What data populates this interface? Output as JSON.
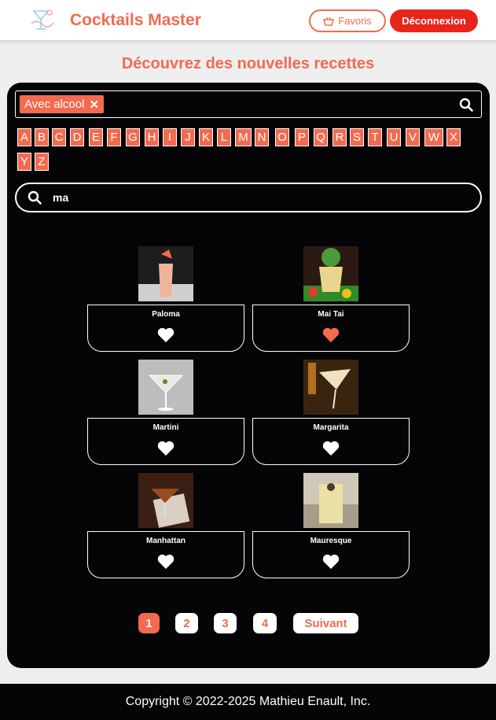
{
  "header": {
    "brand": "Cocktails Master",
    "favorites_label": "Favoris",
    "logout_label": "Déconnexion"
  },
  "page_title": "Découvrez des nouvelles recettes",
  "filter": {
    "tag_label": "Avec alcool",
    "tag_remove": "✕"
  },
  "letters": [
    "A",
    "B",
    "C",
    "D",
    "E",
    "F",
    "G",
    "H",
    "I",
    "J",
    "K",
    "L",
    "M",
    "N",
    "O",
    "P",
    "Q",
    "R",
    "S",
    "T",
    "U",
    "V",
    "W",
    "X",
    "Y",
    "Z"
  ],
  "search": {
    "value": "ma"
  },
  "cocktails": [
    {
      "name": "Paloma",
      "favorite": false
    },
    {
      "name": "Mai Tai",
      "favorite": true
    },
    {
      "name": "Martini",
      "favorite": false
    },
    {
      "name": "Margarita",
      "favorite": false
    },
    {
      "name": "Manhattan",
      "favorite": false
    },
    {
      "name": "Mauresque",
      "favorite": false
    }
  ],
  "pagination": {
    "pages": [
      "1",
      "2",
      "3",
      "4"
    ],
    "active": "1",
    "next_label": "Suivant"
  },
  "footer": "Copyright © 2022-2025 Mathieu Enault, Inc.",
  "colors": {
    "accent": "#f36a4f",
    "logout": "#e8251c",
    "panel": "#050507"
  }
}
